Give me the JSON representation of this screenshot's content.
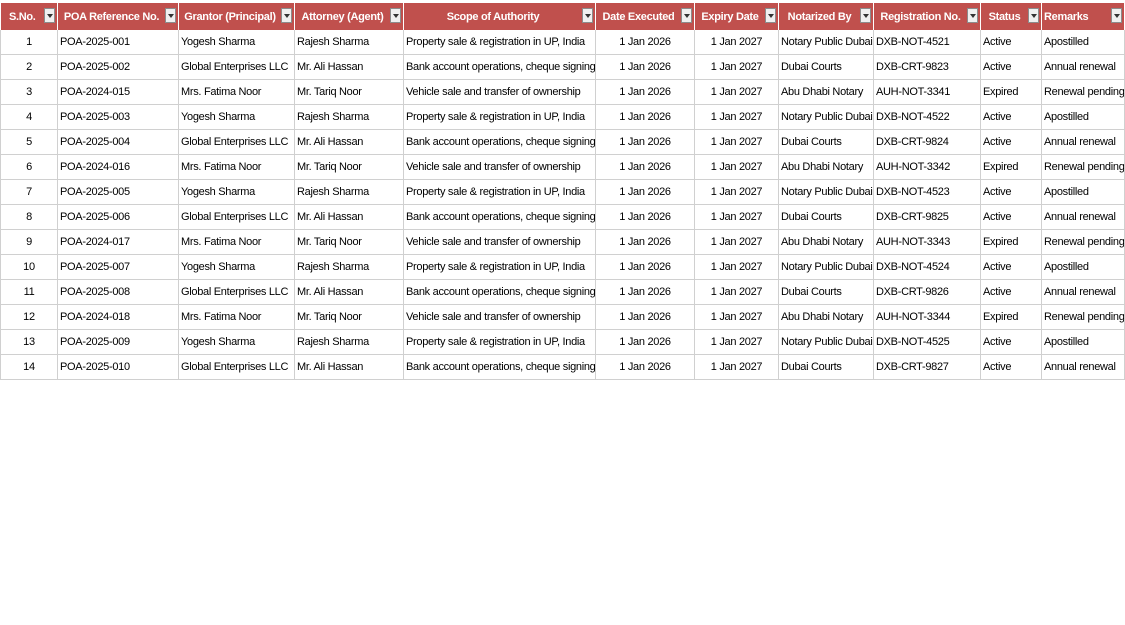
{
  "columns": [
    {
      "label": "S.No.",
      "align": "center"
    },
    {
      "label": "POA Reference No.",
      "align": "center"
    },
    {
      "label": "Grantor (Principal)",
      "align": "center"
    },
    {
      "label": "Attorney (Agent)",
      "align": "center"
    },
    {
      "label": "Scope of Authority",
      "align": "center"
    },
    {
      "label": "Date Executed",
      "align": "center"
    },
    {
      "label": "Expiry Date",
      "align": "center"
    },
    {
      "label": "Notarized By",
      "align": "center"
    },
    {
      "label": "Registration No.",
      "align": "center"
    },
    {
      "label": "Status",
      "align": "center"
    },
    {
      "label": "Remarks",
      "align": "left"
    }
  ],
  "rows": [
    [
      "1",
      "POA-2025-001",
      "Yogesh Sharma",
      "Rajesh Sharma",
      "Property sale & registration in UP, India",
      "1 Jan 2026",
      "1 Jan 2027",
      "Notary Public Dubai",
      "DXB-NOT-4521",
      "Active",
      "Apostilled"
    ],
    [
      "2",
      "POA-2025-002",
      "Global Enterprises LLC",
      "Mr. Ali Hassan",
      "Bank account operations, cheque signing",
      "1 Jan 2026",
      "1 Jan 2027",
      "Dubai Courts",
      "DXB-CRT-9823",
      "Active",
      "Annual renewal"
    ],
    [
      "3",
      "POA-2024-015",
      "Mrs. Fatima Noor",
      "Mr. Tariq Noor",
      "Vehicle sale and transfer of ownership",
      "1 Jan 2026",
      "1 Jan 2027",
      "Abu Dhabi Notary",
      "AUH-NOT-3341",
      "Expired",
      "Renewal pending"
    ],
    [
      "4",
      "POA-2025-003",
      "Yogesh Sharma",
      "Rajesh Sharma",
      "Property sale & registration in UP, India",
      "1 Jan 2026",
      "1 Jan 2027",
      "Notary Public Dubai",
      "DXB-NOT-4522",
      "Active",
      "Apostilled"
    ],
    [
      "5",
      "POA-2025-004",
      "Global Enterprises LLC",
      "Mr. Ali Hassan",
      "Bank account operations, cheque signing",
      "1 Jan 2026",
      "1 Jan 2027",
      "Dubai Courts",
      "DXB-CRT-9824",
      "Active",
      "Annual renewal"
    ],
    [
      "6",
      "POA-2024-016",
      "Mrs. Fatima Noor",
      "Mr. Tariq Noor",
      "Vehicle sale and transfer of ownership",
      "1 Jan 2026",
      "1 Jan 2027",
      "Abu Dhabi Notary",
      "AUH-NOT-3342",
      "Expired",
      "Renewal pending"
    ],
    [
      "7",
      "POA-2025-005",
      "Yogesh Sharma",
      "Rajesh Sharma",
      "Property sale & registration in UP, India",
      "1 Jan 2026",
      "1 Jan 2027",
      "Notary Public Dubai",
      "DXB-NOT-4523",
      "Active",
      "Apostilled"
    ],
    [
      "8",
      "POA-2025-006",
      "Global Enterprises LLC",
      "Mr. Ali Hassan",
      "Bank account operations, cheque signing",
      "1 Jan 2026",
      "1 Jan 2027",
      "Dubai Courts",
      "DXB-CRT-9825",
      "Active",
      "Annual renewal"
    ],
    [
      "9",
      "POA-2024-017",
      "Mrs. Fatima Noor",
      "Mr. Tariq Noor",
      "Vehicle sale and transfer of ownership",
      "1 Jan 2026",
      "1 Jan 2027",
      "Abu Dhabi Notary",
      "AUH-NOT-3343",
      "Expired",
      "Renewal pending"
    ],
    [
      "10",
      "POA-2025-007",
      "Yogesh Sharma",
      "Rajesh Sharma",
      "Property sale & registration in UP, India",
      "1 Jan 2026",
      "1 Jan 2027",
      "Notary Public Dubai",
      "DXB-NOT-4524",
      "Active",
      "Apostilled"
    ],
    [
      "11",
      "POA-2025-008",
      "Global Enterprises LLC",
      "Mr. Ali Hassan",
      "Bank account operations, cheque signing",
      "1 Jan 2026",
      "1 Jan 2027",
      "Dubai Courts",
      "DXB-CRT-9826",
      "Active",
      "Annual renewal"
    ],
    [
      "12",
      "POA-2024-018",
      "Mrs. Fatima Noor",
      "Mr. Tariq Noor",
      "Vehicle sale and transfer of ownership",
      "1 Jan 2026",
      "1 Jan 2027",
      "Abu Dhabi Notary",
      "AUH-NOT-3344",
      "Expired",
      "Renewal pending"
    ],
    [
      "13",
      "POA-2025-009",
      "Yogesh Sharma",
      "Rajesh Sharma",
      "Property sale & registration in UP, India",
      "1 Jan 2026",
      "1 Jan 2027",
      "Notary Public Dubai",
      "DXB-NOT-4525",
      "Active",
      "Apostilled"
    ],
    [
      "14",
      "POA-2025-010",
      "Global Enterprises LLC",
      "Mr. Ali Hassan",
      "Bank account operations, cheque signing",
      "1 Jan 2026",
      "1 Jan 2027",
      "Dubai Courts",
      "DXB-CRT-9827",
      "Active",
      "Annual renewal"
    ]
  ],
  "cell_align": [
    "center",
    "left",
    "left",
    "left",
    "left",
    "center",
    "center",
    "left",
    "left",
    "left",
    "left"
  ],
  "icons": {
    "filter": "filter-dropdown-icon"
  },
  "colors": {
    "header_bg": "#c0504d",
    "header_text": "#ffffff",
    "grid": "#d0d0d0"
  }
}
